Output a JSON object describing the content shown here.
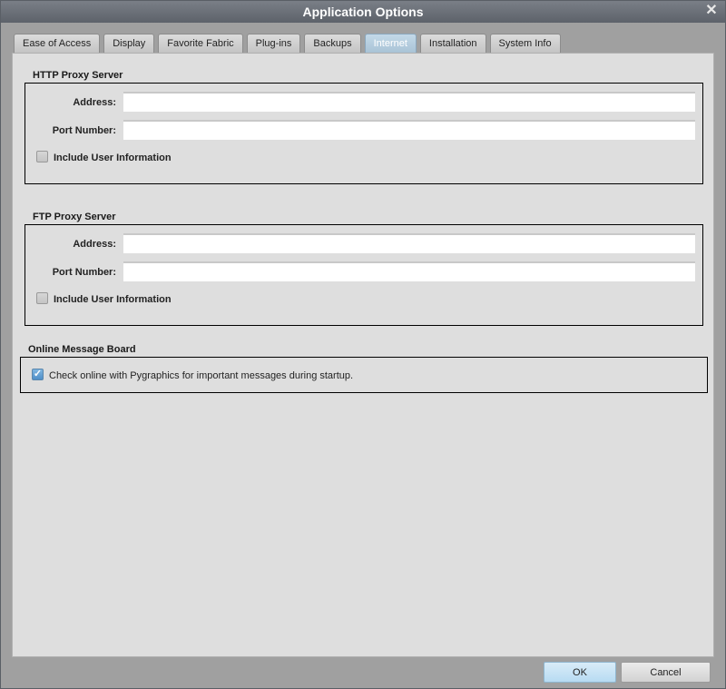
{
  "window": {
    "title": "Application Options"
  },
  "tabs": [
    {
      "label": "Ease of Access",
      "active": false
    },
    {
      "label": "Display",
      "active": false
    },
    {
      "label": "Favorite Fabric",
      "active": false
    },
    {
      "label": "Plug-ins",
      "active": false
    },
    {
      "label": "Backups",
      "active": false
    },
    {
      "label": "Internet",
      "active": true
    },
    {
      "label": "Installation",
      "active": false
    },
    {
      "label": "System Info",
      "active": false
    }
  ],
  "http_proxy": {
    "title": "HTTP Proxy Server",
    "address_label": "Address:",
    "address_value": "",
    "port_label": "Port Number:",
    "port_value": "",
    "include_user_label": "Include User Information",
    "include_user_checked": false
  },
  "ftp_proxy": {
    "title": "FTP Proxy Server",
    "address_label": "Address:",
    "address_value": "",
    "port_label": "Port Number:",
    "port_value": "",
    "include_user_label": "Include User Information",
    "include_user_checked": false
  },
  "message_board": {
    "title": "Online Message Board",
    "check_label": "Check online with Pygraphics for important messages during startup.",
    "checked": true
  },
  "buttons": {
    "ok": "OK",
    "cancel": "Cancel"
  },
  "icons": {
    "close": "✕",
    "check": "✓"
  }
}
